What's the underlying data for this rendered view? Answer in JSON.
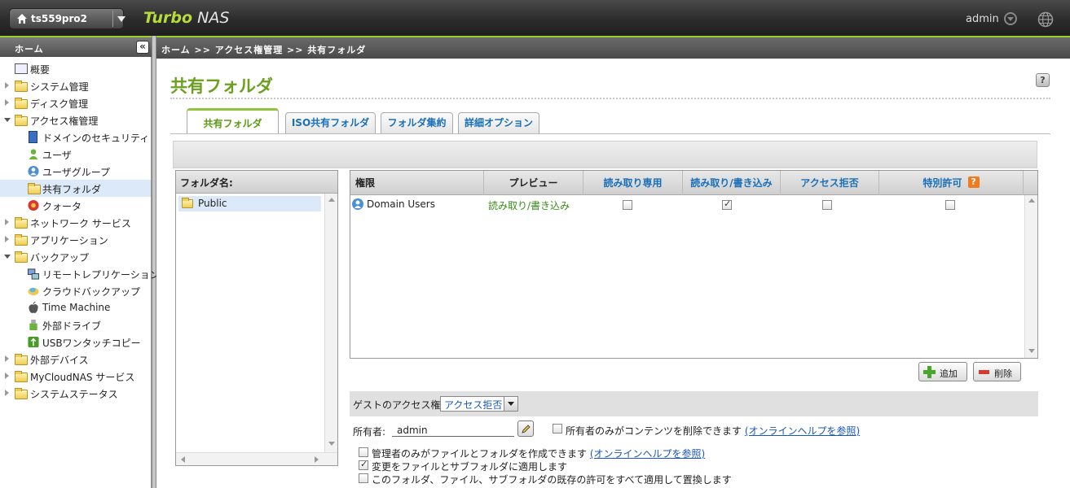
{
  "topbar": {
    "host": "ts559pro2",
    "brand_turbo": "Turbo",
    "brand_nas": "NAS",
    "user": "admin"
  },
  "sidebar": {
    "header": "ホーム",
    "collapse_label": "«",
    "items": [
      {
        "label": "概要"
      },
      {
        "label": "システム管理"
      },
      {
        "label": "ディスク管理"
      },
      {
        "label": "アクセス権管理"
      },
      {
        "label": "ドメインのセキュリティ"
      },
      {
        "label": "ユーザ"
      },
      {
        "label": "ユーザグループ"
      },
      {
        "label": "共有フォルダ"
      },
      {
        "label": "クォータ"
      },
      {
        "label": "ネットワーク サービス"
      },
      {
        "label": "アプリケーション"
      },
      {
        "label": "バックアップ"
      },
      {
        "label": "リモートレプリケーション"
      },
      {
        "label": "クラウドバックアップ"
      },
      {
        "label": "Time Machine"
      },
      {
        "label": "外部ドライブ"
      },
      {
        "label": "USBワンタッチコピー"
      },
      {
        "label": "外部デバイス"
      },
      {
        "label": "MyCloudNAS サービス"
      },
      {
        "label": "システムステータス"
      }
    ]
  },
  "breadcrumb": "ホーム >> アクセス権管理 >> 共有フォルダ",
  "page": {
    "title": "共有フォルダ",
    "help": "?",
    "tabs": [
      {
        "label": "共有フォルダ"
      },
      {
        "label": "ISO共有フォルダ"
      },
      {
        "label": "フォルダ集約"
      },
      {
        "label": "詳細オプション"
      }
    ]
  },
  "folders": {
    "header": "フォルダ名:",
    "items": [
      {
        "name": "Public"
      }
    ]
  },
  "permissions": {
    "columns": [
      "権限",
      "プレビュー",
      "読み取り専用",
      "読み取り/書き込み",
      "アクセス拒否",
      "特別許可"
    ],
    "special_help": "?",
    "rows": [
      {
        "name": "Domain Users",
        "preview": "読み取り/書き込み",
        "read_only": false,
        "read_write": true,
        "deny": false,
        "special": false
      }
    ],
    "add_label": "追加",
    "delete_label": "削除"
  },
  "guest": {
    "label": "ゲストのアクセス権:",
    "value": "アクセス拒否"
  },
  "owner": {
    "label": "所有者:",
    "value": "admin",
    "only_owner_delete": "所有者のみがコンテンツを削除できます",
    "help_link": "(オンラインヘルプを参照)"
  },
  "options": [
    {
      "label": "管理者のみがファイルとフォルダを作成できます",
      "link": "(オンラインヘルプを参照)",
      "checked": false
    },
    {
      "label": "変更をファイルとサブフォルダに適用します",
      "link": "",
      "checked": true
    },
    {
      "label": "このフォルダ、ファイル、サブフォルダの既存の許可をすべて適用して置換します",
      "link": "",
      "checked": false
    }
  ],
  "colors": {
    "accent_green": "#6ba01f",
    "link_blue": "#1a70b8",
    "selection": "#dbe9f9"
  }
}
